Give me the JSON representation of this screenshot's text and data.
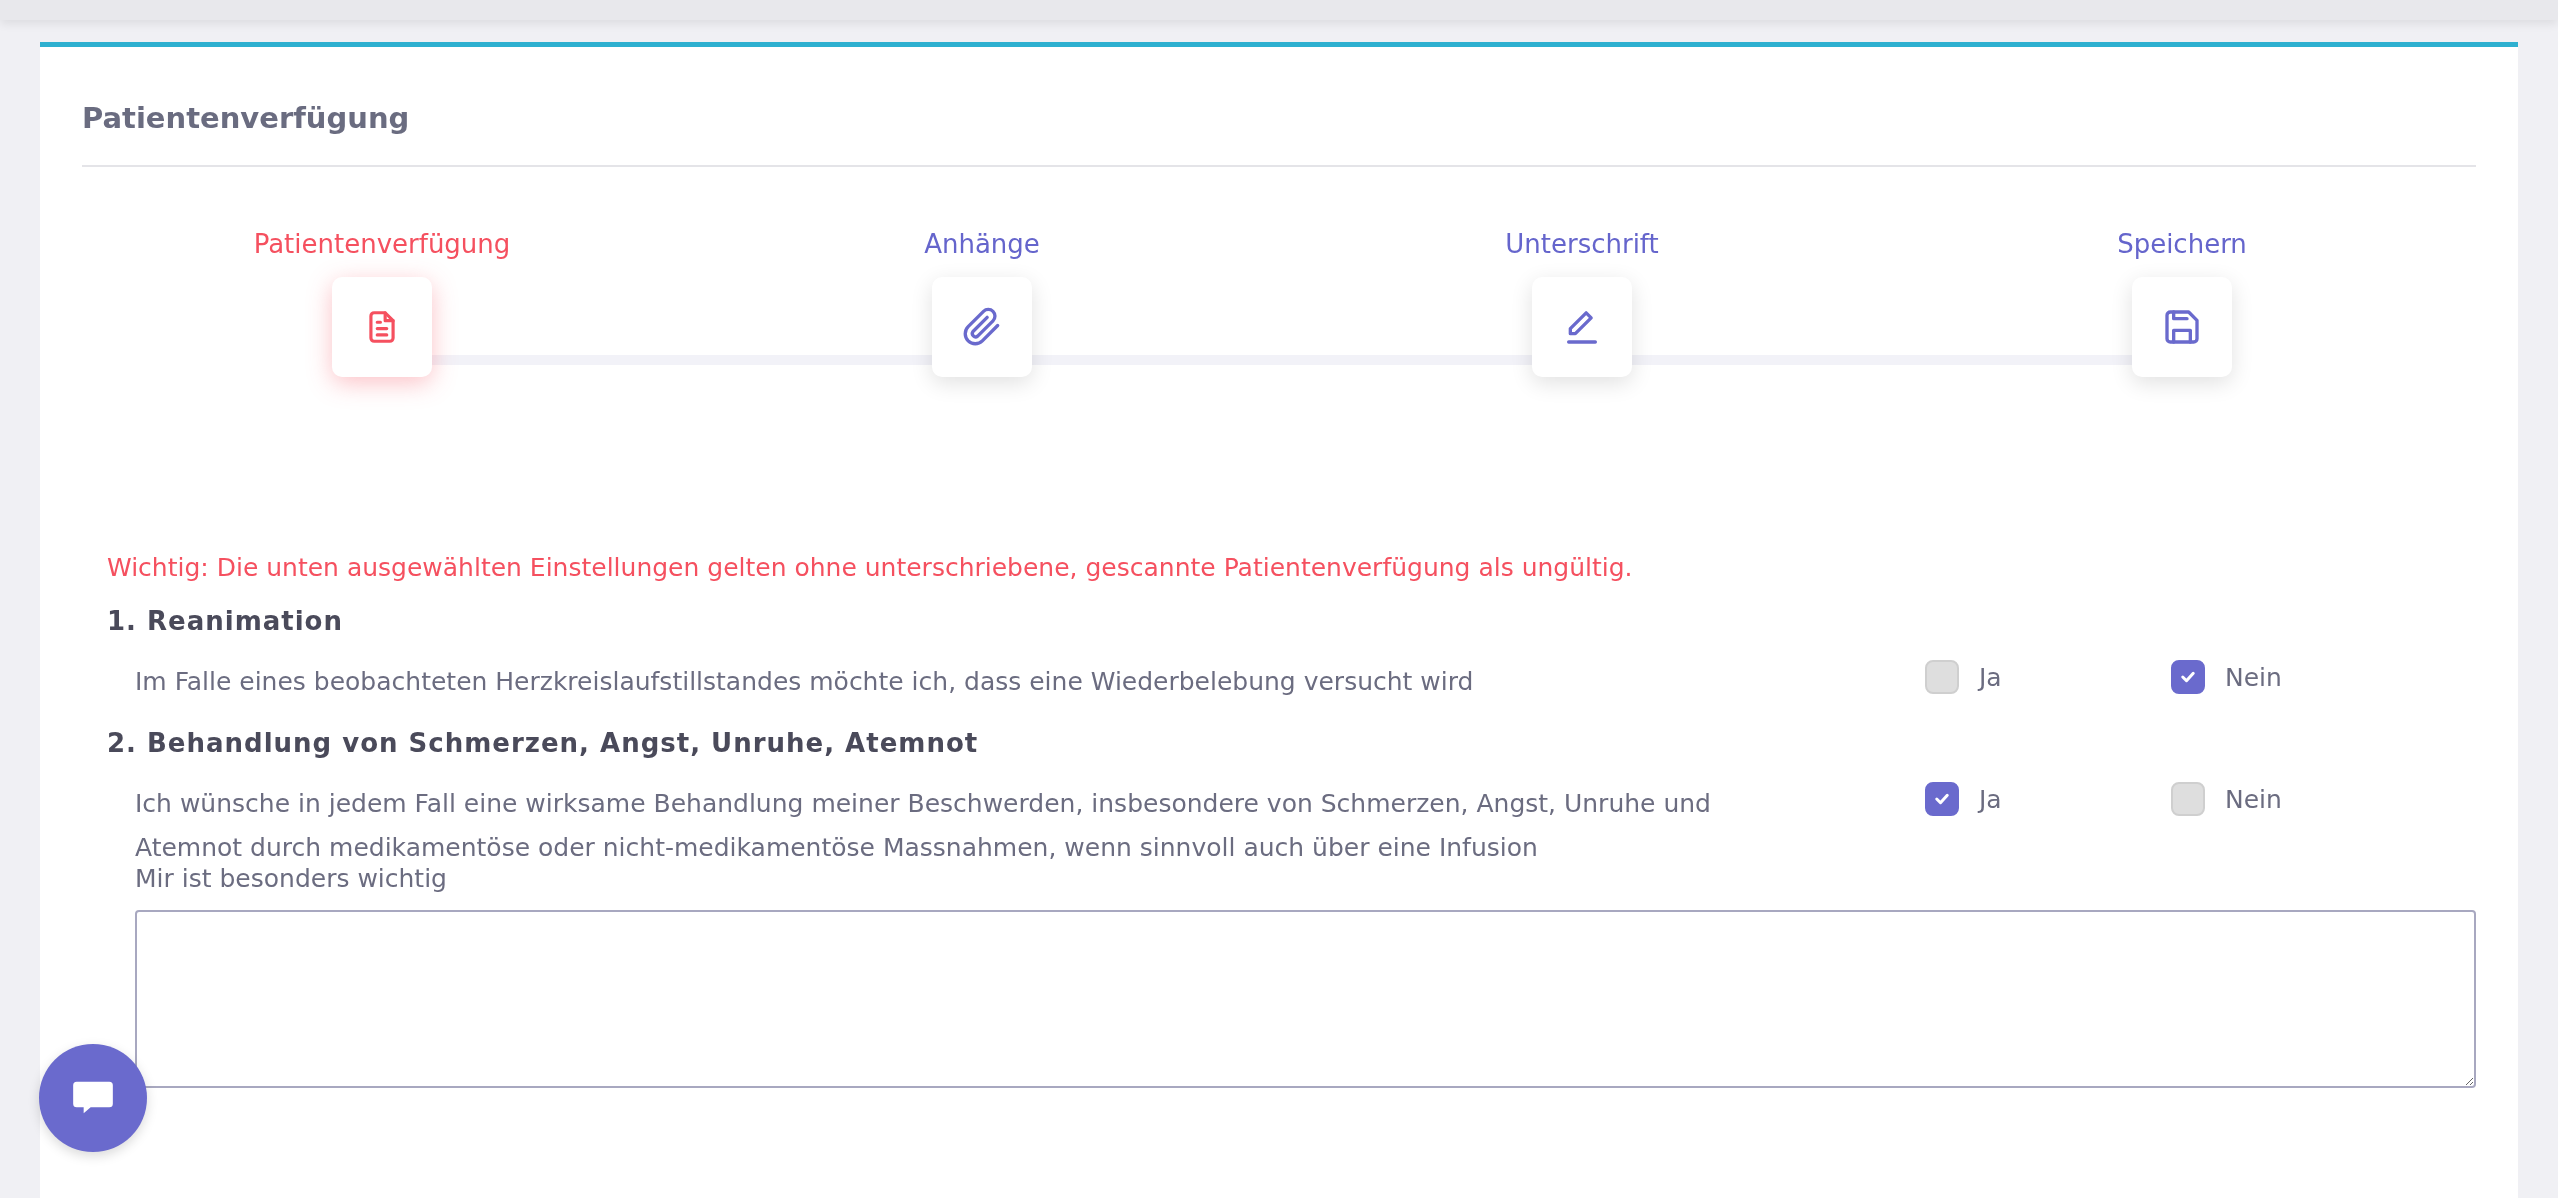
{
  "card": {
    "title": "Patientenverfügung"
  },
  "steps": [
    {
      "label": "Patientenverfügung",
      "kind": "document",
      "selected": true
    },
    {
      "label": "Anhänge",
      "kind": "paperclip",
      "selected": false
    },
    {
      "label": "Unterschrift",
      "kind": "pen",
      "selected": false
    },
    {
      "label": "Speichern",
      "kind": "floppy",
      "selected": false
    }
  ],
  "warning": "Wichtig: Die unten ausgewählten Einstellungen gelten ohne unterschriebene, gescannte Patientenverfügung als ungültig.",
  "sections": [
    {
      "heading": "1. Reanimation",
      "text": "Im Falle eines beobachteten Herzkreislaufstillstandes möchte ich, dass eine Wiederbelebung versucht wird",
      "options": [
        {
          "label": "Ja",
          "checked": false
        },
        {
          "label": "Nein",
          "checked": true
        }
      ]
    },
    {
      "heading": "2. Behandlung von Schmerzen, Angst, Unruhe, Atemnot",
      "text": "Ich wünsche in jedem Fall eine wirksame Behandlung meiner Beschwerden, insbesondere von Schmerzen, Angst, Unruhe und Atemnot durch medikamentöse oder nicht-medikamentöse Massnahmen, wenn sinnvoll auch über eine Infusion",
      "options": [
        {
          "label": "Ja",
          "checked": true
        },
        {
          "label": "Nein",
          "checked": false
        }
      ],
      "note_label": "Mir ist besonders wichtig"
    }
  ]
}
